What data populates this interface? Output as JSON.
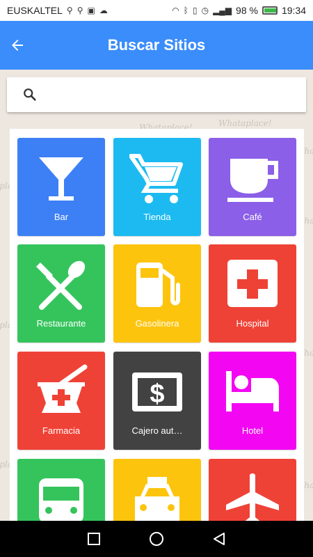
{
  "status_bar": {
    "carrier": "EUSKALTEL",
    "battery_percent": "98 %",
    "time": "19:34"
  },
  "app_bar": {
    "title": "Buscar Sitios",
    "back_icon": "arrow-back-icon"
  },
  "search": {
    "placeholder": "",
    "value": "",
    "icon": "search-icon"
  },
  "watermark_text": "Whataplace!",
  "categories": [
    {
      "label": "Bar",
      "icon": "cocktail-icon",
      "color": "#3d7ff5"
    },
    {
      "label": "Tienda",
      "icon": "shopping-cart-icon",
      "color": "#1cbaf0"
    },
    {
      "label": "Café",
      "icon": "coffee-cup-icon",
      "color": "#8b5fe8"
    },
    {
      "label": "Restaurante",
      "icon": "fork-spoon-icon",
      "color": "#35c45c"
    },
    {
      "label": "Gasolinera",
      "icon": "gas-pump-icon",
      "color": "#fdc40e"
    },
    {
      "label": "Hospital",
      "icon": "hospital-icon",
      "color": "#ef4236"
    },
    {
      "label": "Farmacia",
      "icon": "mortar-pestle-icon",
      "color": "#ef4236"
    },
    {
      "label": "Cajero aut…",
      "icon": "atm-icon",
      "color": "#424242"
    },
    {
      "label": "Hotel",
      "icon": "bed-icon",
      "color": "#f307f3"
    },
    {
      "label": "",
      "icon": "bus-icon",
      "color": "#35c45c"
    },
    {
      "label": "",
      "icon": "taxi-icon",
      "color": "#fdc40e"
    },
    {
      "label": "",
      "icon": "airplane-icon",
      "color": "#ef4236"
    }
  ]
}
